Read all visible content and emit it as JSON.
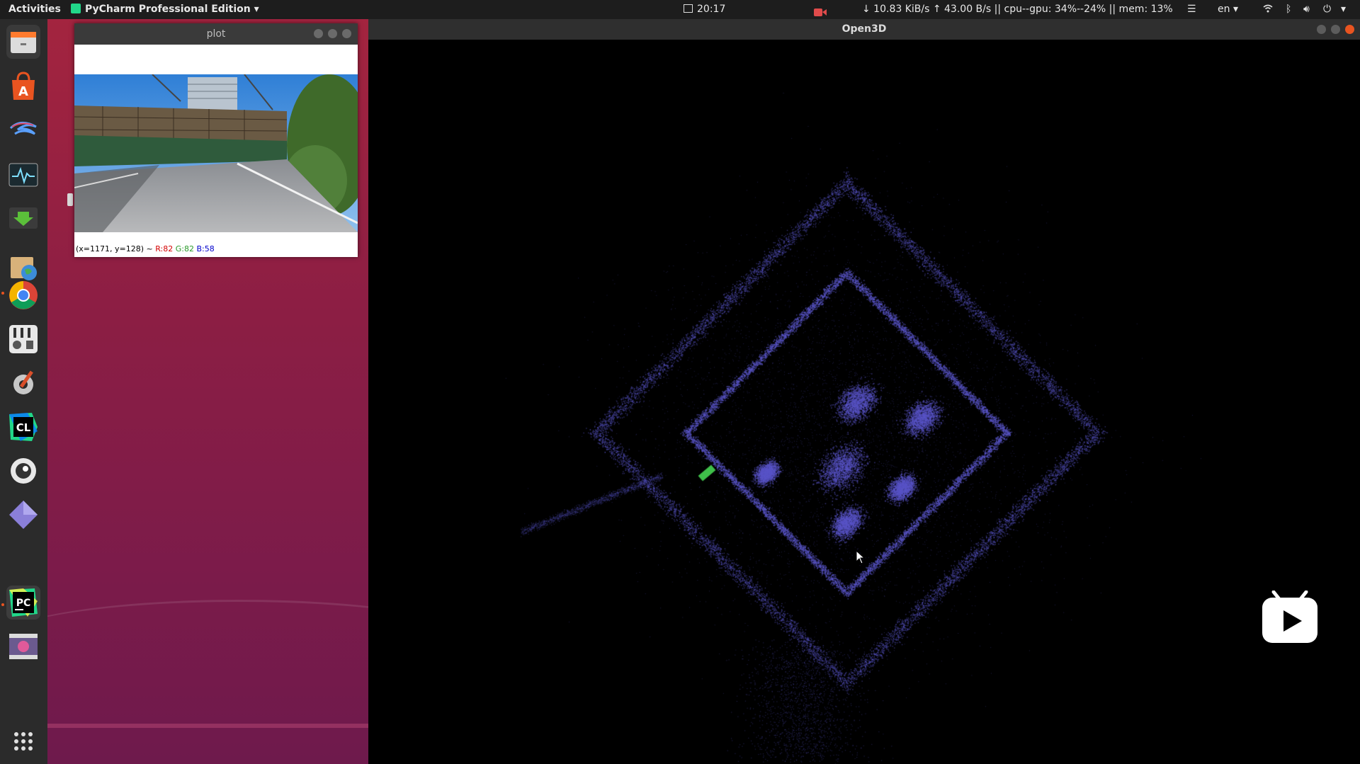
{
  "topbar": {
    "activities": "Activities",
    "app_menu": "PyCharm Professional Edition",
    "clock": "20:17",
    "net_stats": "↓ 10.83 KiB/s ↑ 43.00 B/s || cpu--gpu: 34%--24% || mem: 13%",
    "language": "en"
  },
  "dock": {
    "items": [
      {
        "name": "files",
        "label": "▭",
        "color": "#3c3c3c"
      },
      {
        "name": "software-center",
        "label": "A",
        "color": "#e95420"
      },
      {
        "name": "kali-dragon",
        "label": "≈",
        "color": "#2b2b2b"
      },
      {
        "name": "system-monitor",
        "label": "∿",
        "color": "#1e2a30"
      },
      {
        "name": "terminal-download",
        "label": "↓",
        "color": "#2e7d32"
      },
      {
        "name": "web-archive",
        "label": "◎",
        "color": "#c9a56a"
      },
      {
        "name": "chrome",
        "label": "●",
        "color": "#2b2b2b"
      },
      {
        "name": "mixer",
        "label": "⁞",
        "color": "#e0e0e0"
      },
      {
        "name": "settings-tools",
        "label": "⚙",
        "color": "#2b2b2b"
      },
      {
        "name": "clion",
        "label": "CL",
        "color": "#21a0b3"
      },
      {
        "name": "eye-app",
        "label": "◉",
        "color": "#2b2b2b"
      },
      {
        "name": "diamond-app",
        "label": "◆",
        "color": "#2b2b2b"
      },
      {
        "name": "pycharm",
        "label": "PC",
        "color": "#111111"
      },
      {
        "name": "video-app",
        "label": "▤",
        "color": "#5c4a7a"
      }
    ],
    "apps_grid": "⋮⋮⋮"
  },
  "plot_window": {
    "title": "plot",
    "status_coords": "(x=1171, y=128) ~",
    "status_r": "R:82",
    "status_g": "G:82",
    "status_b": "B:58"
  },
  "open3d_window": {
    "title": "Open3D",
    "point_color": "#5a55c8",
    "marker_color": "#3fbf4a"
  },
  "colors": {
    "ubuntu_orange": "#e95420",
    "dock_bg": "#2b2b2b",
    "topbar_bg": "#1d1d1d"
  }
}
